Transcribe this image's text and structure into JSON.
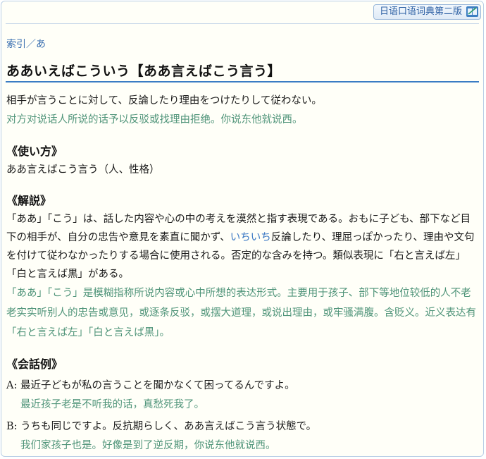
{
  "badge": {
    "label": "日语口语词典第二版"
  },
  "breadcrumb": {
    "index": "索引",
    "sep": "／",
    "current": "あ"
  },
  "title": "ああいえばこういう【ああ言えばこう言う】",
  "definition": {
    "jp": "相手が言うことに対して、反論したり理由をつけたりして従わない。",
    "zh": "对方对说话人所说的话予以反驳或找理由拒绝。你说东他就说西。"
  },
  "usage": {
    "heading": "《使い方》",
    "jp": "ああ言えばこう言う（人、性格）"
  },
  "explanation": {
    "heading": "《解説》",
    "jp_part1": "「ああ」「こう」は、話した内容や心の中の考えを漠然と指す表現である。おもに子ども、部下など目下の相手が、自分の忠告や意見を素直に聞かず、",
    "link": "いちいち",
    "jp_part2": "反論したり、理屈っぽかったり、理由や文句を付けて従わなかったりする場合に使用される。否定的な含みを持つ。類似表現に「右と言えば左」「白と言えば黒」がある。",
    "zh": "「ああ」「こう」是模糊指称所说内容或心中所想的表达形式。主要用于孩子、部下等地位较低的人不老老实实听别人的忠告或意见，或逐条反驳，或摆大道理，或说出理由，或牢骚满腹。含贬义。近义表达有「右と言えば左」「白と言えば黒」。"
  },
  "conversation": {
    "heading": "《会話例》",
    "lines": [
      {
        "speaker": "A:",
        "jp": "最近子どもが私の言うことを聞かなくて困ってるんですよ。",
        "zh": "最近孩子老是不听我的话，真愁死我了。"
      },
      {
        "speaker": "B:",
        "jp": "うちも同じですよ。反抗期らしく、ああ言えばこう言う状態で。",
        "zh": "我们家孩子也是。好像是到了逆反期，你说东他就说西。"
      }
    ]
  }
}
